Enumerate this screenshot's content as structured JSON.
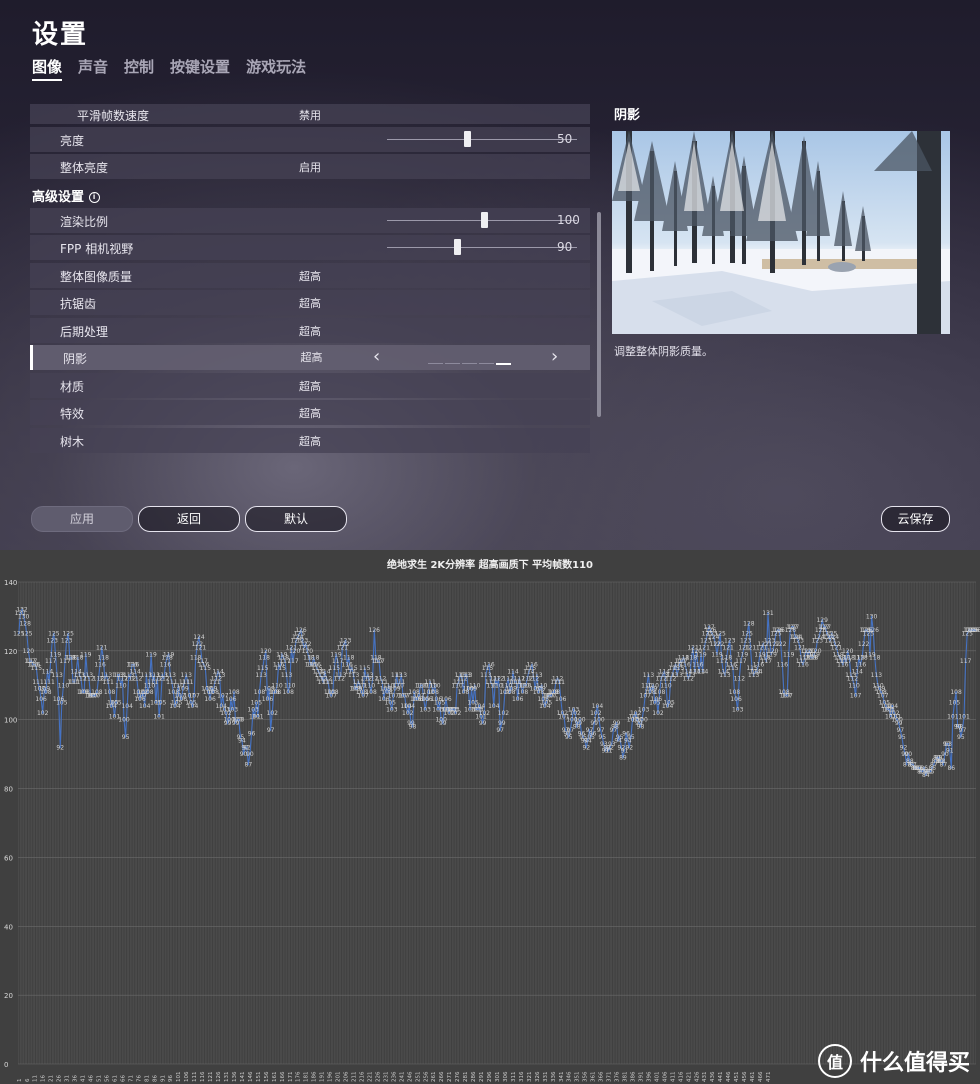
{
  "settings": {
    "title": "设置",
    "tabs": [
      "图像",
      "声音",
      "控制",
      "按键设置",
      "游戏玩法"
    ],
    "rows_top": [
      {
        "label": "平滑帧数速度",
        "value": "禁用"
      },
      {
        "label": "亮度",
        "slider": 50,
        "value": "50"
      },
      {
        "label": "整体亮度",
        "value": "启用"
      }
    ],
    "section_label": "高级设置",
    "info_icon": "info-icon",
    "rows_adv": [
      {
        "label": "渲染比例",
        "slider": 100,
        "value": "100"
      },
      {
        "label": "FPP 相机视野",
        "slider": 90,
        "value": "90"
      },
      {
        "label": "整体图像质量",
        "value": "超高"
      },
      {
        "label": "抗锯齿",
        "value": "超高"
      },
      {
        "label": "后期处理",
        "value": "超高"
      },
      {
        "label": "阴影",
        "value": "超高",
        "selected": true
      },
      {
        "label": "材质",
        "value": "超高"
      },
      {
        "label": "特效",
        "value": "超高"
      },
      {
        "label": "树木",
        "value": "超高"
      }
    ],
    "preview_title": "阴影",
    "preview_desc": "调整整体阴影质量。",
    "buttons": {
      "apply": "应用",
      "back": "返回",
      "default": "默认",
      "cloud": "云保存"
    }
  },
  "watermark": "什么值得买",
  "chart_data": {
    "type": "line",
    "title": "绝地求生 2K分辨率 超高画质下 平均帧数110",
    "ylim": [
      0,
      140
    ],
    "yticks": [
      0,
      20,
      40,
      60,
      80,
      100,
      120,
      140
    ],
    "grid": true,
    "color": "#4472c4",
    "x": {
      "start": 1,
      "step": 1
    },
    "series": [
      {
        "values": [
          125,
          131,
          132,
          130,
          128,
          125,
          120,
          117,
          117,
          116,
          116,
          115,
          111,
          109,
          106,
          102,
          109,
          108,
          114,
          111,
          117,
          123,
          125,
          119,
          113,
          106,
          92,
          105,
          110,
          117,
          123,
          125,
          118,
          118,
          111,
          111,
          114,
          118,
          113,
          112,
          108,
          108,
          119,
          113,
          112,
          107,
          107,
          107,
          107,
          108,
          112,
          116,
          121,
          118,
          112,
          113,
          111,
          108,
          104,
          105,
          101,
          105,
          113,
          113,
          110,
          112,
          100,
          95,
          104,
          113,
          112,
          116,
          116,
          114,
          112,
          108,
          106,
          107,
          108,
          104,
          113,
          108,
          110,
          119,
          111,
          113,
          105,
          112,
          101,
          105,
          113,
          112,
          116,
          118,
          119,
          113,
          111,
          108,
          104,
          105,
          110,
          107,
          106,
          109,
          111,
          113,
          111,
          107,
          105,
          104,
          107,
          118,
          122,
          124,
          121,
          117,
          116,
          115,
          109,
          108,
          106,
          109,
          108,
          111,
          112,
          114,
          113,
          104,
          107,
          103,
          102,
          99,
          100,
          106,
          103,
          108,
          99,
          100,
          100,
          95,
          94,
          90,
          92,
          92,
          87,
          90,
          96,
          103,
          101,
          105,
          101,
          108,
          113,
          115,
          118,
          120,
          106,
          109,
          97,
          102,
          108,
          108,
          110,
          116,
          115,
          119,
          118,
          117,
          113,
          108,
          110,
          121,
          117,
          120,
          123,
          124,
          125,
          126,
          123,
          121,
          122,
          120,
          118,
          116,
          116,
          118,
          116,
          115,
          114,
          113,
          112,
          111,
          114,
          112,
          111,
          108,
          107,
          108,
          115,
          119,
          117,
          112,
          113,
          121,
          122,
          123,
          116,
          118,
          114,
          115,
          113,
          109,
          109,
          111,
          110,
          108,
          107,
          115,
          112,
          113,
          110,
          108,
          112,
          126,
          118,
          117,
          117,
          112,
          111,
          106,
          109,
          108,
          110,
          105,
          103,
          107,
          109,
          113,
          110,
          111,
          113,
          107,
          107,
          104,
          102,
          104,
          99,
          98,
          108,
          106,
          106,
          107,
          110,
          110,
          106,
          103,
          106,
          108,
          111,
          110,
          108,
          110,
          106,
          103,
          105,
          100,
          99,
          103,
          106,
          103,
          102,
          103,
          103,
          103,
          102,
          110,
          111,
          113,
          112,
          108,
          113,
          113,
          109,
          103,
          109,
          105,
          110,
          103,
          103,
          104,
          101,
          99,
          102,
          113,
          115,
          116,
          111,
          110,
          104,
          112,
          110,
          112,
          97,
          99,
          102,
          108,
          110,
          112,
          108,
          109,
          114,
          111,
          111,
          106,
          112,
          110,
          108,
          110,
          110,
          112,
          114,
          115,
          116,
          112,
          109,
          113,
          108,
          109,
          110,
          106,
          104,
          105,
          107,
          107,
          107,
          108,
          108,
          111,
          112,
          111,
          106,
          102,
          101,
          97,
          96,
          95,
          97,
          100,
          103,
          102,
          98,
          99,
          100,
          96,
          95,
          94,
          92,
          94,
          97,
          95,
          96,
          99,
          102,
          104,
          100,
          97,
          95,
          93,
          91,
          92,
          91,
          92,
          93,
          97,
          98,
          99,
          94,
          95,
          92,
          89,
          91,
          96,
          94,
          92,
          95,
          100,
          101,
          102,
          100,
          99,
          98,
          100,
          103,
          107,
          110,
          113,
          108,
          109,
          110,
          105,
          106,
          102,
          108,
          112,
          113,
          114,
          110,
          104,
          105,
          112,
          113,
          115,
          116,
          113,
          115,
          117,
          117,
          118,
          116,
          114,
          112,
          113,
          118,
          121,
          114,
          120,
          116,
          114,
          119,
          114,
          121,
          123,
          125,
          127,
          126,
          125,
          124,
          122,
          119,
          122,
          125,
          117,
          114,
          113,
          118,
          121,
          123,
          116,
          115,
          108,
          106,
          103,
          112,
          117,
          119,
          121,
          123,
          125,
          128,
          121,
          115,
          113,
          114,
          114,
          116,
          119,
          121,
          122,
          118,
          117,
          131,
          123,
          119,
          120,
          122,
          125,
          126,
          126,
          122,
          116,
          108,
          107,
          107,
          119,
          126,
          127,
          127,
          124,
          124,
          123,
          121,
          117,
          116,
          118,
          120,
          119,
          120,
          118,
          118,
          119,
          120,
          123,
          124,
          126,
          129,
          127,
          127,
          125,
          124,
          123,
          125,
          124,
          122,
          121,
          119,
          118,
          117,
          116,
          118,
          117,
          120,
          118,
          113,
          112,
          110,
          107,
          114,
          118,
          116,
          118,
          122,
          126,
          126,
          125,
          119,
          130,
          126,
          118,
          113,
          110,
          109,
          108,
          107,
          105,
          104,
          103,
          103,
          101,
          104,
          102,
          101,
          100,
          99,
          97,
          95,
          92,
          90,
          87,
          90,
          88,
          87,
          87,
          86,
          86,
          86,
          86,
          85,
          85,
          86,
          84,
          85,
          85,
          85,
          86,
          87,
          88,
          89,
          89,
          88,
          88,
          87,
          90,
          93,
          93,
          91,
          86,
          101,
          105,
          108,
          98,
          98,
          95,
          97,
          101,
          117,
          125,
          126,
          126,
          126,
          126,
          126
        ]
      }
    ],
    "xtick_labels": [
      "1",
      "6",
      "11",
      "16",
      "21",
      "26",
      "31",
      "36",
      "41",
      "46",
      "51",
      "56",
      "61",
      "66",
      "71",
      "76",
      "81",
      "86",
      "91",
      "96",
      "101",
      "106",
      "111",
      "116",
      "121",
      "126",
      "131",
      "136",
      "141",
      "146",
      "151",
      "156",
      "161",
      "166",
      "171",
      "176",
      "181",
      "186",
      "191",
      "196",
      "201",
      "206",
      "211",
      "216",
      "221",
      "226",
      "231",
      "236",
      "241",
      "246",
      "251",
      "256",
      "261",
      "266",
      "271",
      "276",
      "281",
      "286",
      "291",
      "296",
      "301",
      "306",
      "311",
      "316",
      "321",
      "326",
      "331",
      "336",
      "341",
      "346",
      "351",
      "356",
      "361",
      "366",
      "371",
      "376",
      "381",
      "386",
      "391",
      "396",
      "401",
      "406",
      "411",
      "416",
      "421",
      "426",
      "431",
      "436",
      "441",
      "446",
      "451",
      "456",
      "461",
      "466",
      "471"
    ]
  }
}
